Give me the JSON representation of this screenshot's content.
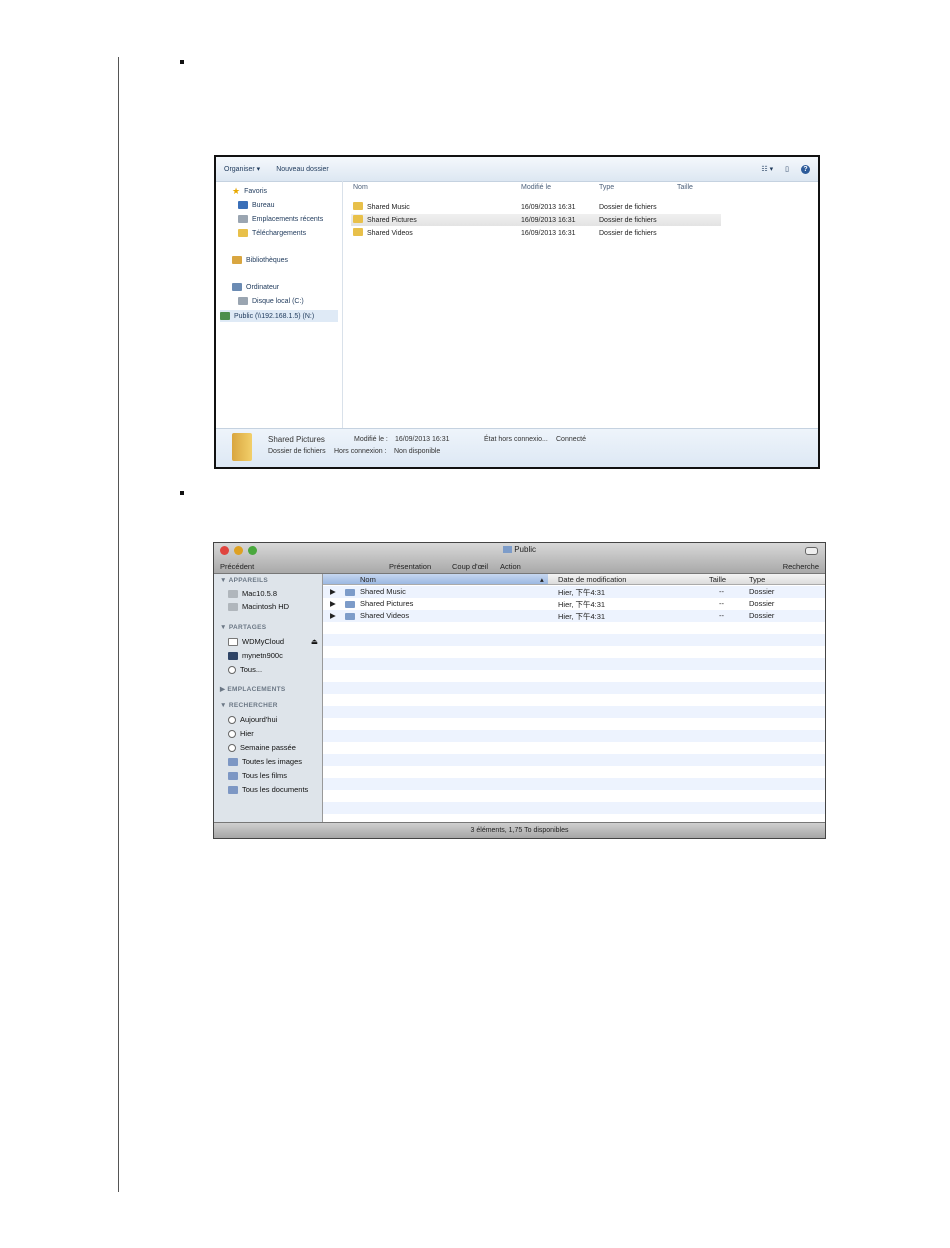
{
  "windows_explorer": {
    "toolbar": {
      "organize": "Organiser ▾",
      "new_folder": "Nouveau dossier"
    },
    "nav": {
      "favorites": "Favoris",
      "desktop": "Bureau",
      "recent": "Emplacements récents",
      "downloads": "Téléchargements",
      "libraries": "Bibliothèques",
      "computer": "Ordinateur",
      "local_disk": "Disque local (C:)",
      "network_share": "Public (\\\\192.168.1.5) (N:)"
    },
    "columns": {
      "name": "Nom",
      "modified": "Modifié le",
      "type": "Type",
      "size": "Taille"
    },
    "rows": [
      {
        "name": "Shared Music",
        "modified": "16/09/2013 16:31",
        "type": "Dossier de fichiers"
      },
      {
        "name": "Shared Pictures",
        "modified": "16/09/2013 16:31",
        "type": "Dossier de fichiers"
      },
      {
        "name": "Shared Videos",
        "modified": "16/09/2013 16:31",
        "type": "Dossier de fichiers"
      }
    ],
    "details": {
      "name": "Shared Pictures",
      "kind": "Dossier de fichiers",
      "modified_label": "Modifié le :",
      "modified_value": "16/09/2013 16:31",
      "offline_label": "Hors connexion :",
      "offline_value": "Non disponible",
      "state_label": "État hors connexio...",
      "state_value": "Connecté"
    }
  },
  "mac_finder": {
    "window_title": "Public",
    "toolbar": {
      "back": "Précédent",
      "view": "Présentation",
      "quicklook": "Coup d'œil",
      "action": "Action",
      "search": "Recherche"
    },
    "sidebar": {
      "devices_header": "▼ APPAREILS",
      "devices": [
        "Mac10.5.8",
        "Macintosh HD"
      ],
      "shared_header": "▼ PARTAGES",
      "shared": [
        "WDMyCloud",
        "mynetn900c",
        "Tous..."
      ],
      "places_header": "▶ EMPLACEMENTS",
      "search_header": "▼ RECHERCHER",
      "search": [
        "Aujourd'hui",
        "Hier",
        "Semaine passée",
        "Toutes les images",
        "Tous les films",
        "Tous les documents"
      ]
    },
    "columns": {
      "name": "Nom",
      "date": "Date de modification",
      "size": "Taille",
      "kind": "Type"
    },
    "rows": [
      {
        "name": "Shared Music",
        "date": "Hier, 下午4:31",
        "size": "--",
        "kind": "Dossier"
      },
      {
        "name": "Shared Pictures",
        "date": "Hier, 下午4:31",
        "size": "--",
        "kind": "Dossier"
      },
      {
        "name": "Shared Videos",
        "date": "Hier, 下午4:31",
        "size": "--",
        "kind": "Dossier"
      }
    ],
    "status": "3 éléments, 1,75 To disponibles",
    "colors": {
      "close": "#e0443e",
      "minimize": "#dea123",
      "zoom": "#4aa83d"
    }
  }
}
